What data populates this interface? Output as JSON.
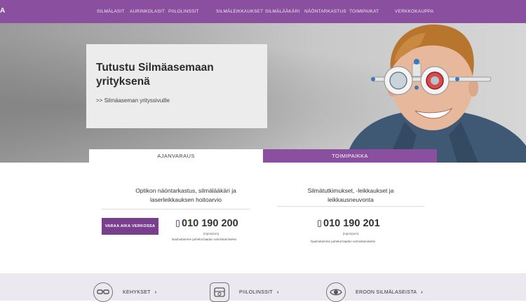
{
  "header": {
    "logo_fragment": "A",
    "nav": [
      "SILMÄLASIT",
      "AURINKOLASIT",
      "PIILOLINSSIT",
      "SILMÄLEIKKAUKSET",
      "SILMÄLÄÄKÄRI",
      "NÄÖNTARKASTUS",
      "TOIMIPAIKAT",
      "VERKKOKAUPPA"
    ]
  },
  "hero": {
    "title": "Tutustu Silmäasemaan yrityksenä",
    "link": ">> Silmäaseman yrityssivuille"
  },
  "tabs": {
    "booking": "AJANVARAUS",
    "location": "TOIMIPAIKKA"
  },
  "contact": {
    "left": {
      "heading_line1": "Optikon näöntarkastus, silmälääkäri ja",
      "heading_line2": "laserleikkauksen hoitoarvio",
      "button": "VARAA AIKA VERKOSSA",
      "phone": "010 190 200",
      "price": "(mpm/pvm)",
      "note": "Nauhoitamme puhelut laadun varmistamiseksi"
    },
    "right": {
      "heading_line1": "Silmätutkimukset, -leikkaukset ja",
      "heading_line2": "leikkausneuvonta",
      "phone": "010 190 201",
      "price": "(mpm/pvm)",
      "note": "Nauhoitamme puhelut laadun varmistamiseksi"
    }
  },
  "bottom_links": [
    {
      "label": "KEHYKSET",
      "icon": "glasses-icon"
    },
    {
      "label": "PIILOLINSSIT",
      "icon": "contact-lens-case-icon"
    },
    {
      "label": "EROON SILMÄLASEISTA",
      "icon": "eye-icon"
    }
  ],
  "colors": {
    "brand_purple": "#8a4f9e",
    "button_purple": "#7a3e8e",
    "bottom_bar": "#ebe8ef"
  }
}
